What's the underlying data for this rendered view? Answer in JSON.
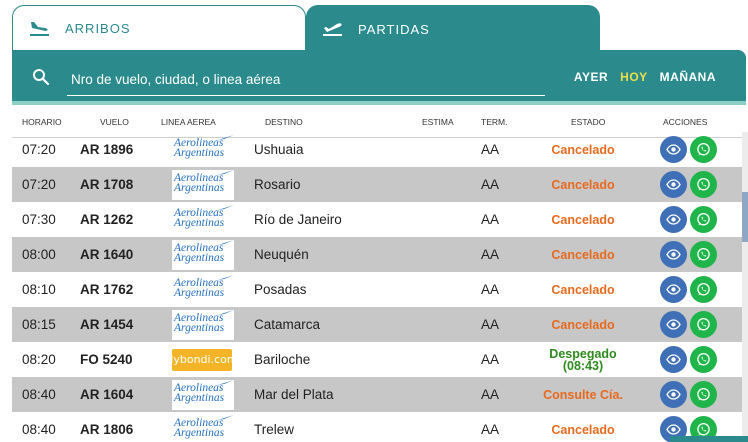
{
  "tabs": {
    "arrivals": "ARRIBOS",
    "departures": "PARTIDAS"
  },
  "search": {
    "placeholder": "Nro de vuelo, ciudad, o linea aérea"
  },
  "days": {
    "yesterday": "AYER",
    "today": "HOY",
    "tomorrow": "MAÑANA"
  },
  "columns": {
    "time": "HORARIO",
    "flight": "VUELO",
    "airline": "LINEA AEREA",
    "destination": "DESTINO",
    "estimate": "ESTIMA",
    "terminal": "TERM.",
    "status": "ESTADO",
    "actions": "ACCIONES"
  },
  "airline_logos": {
    "aerolineas": [
      "Aerolineas",
      "Argentinas"
    ],
    "flybondi": "flybondi.com"
  },
  "colors": {
    "teal": "#2a8a8c",
    "accent_today": "#e8e04a",
    "cancel": "#e86a1f",
    "departed": "#2e8b1e",
    "eye_button": "#3f6fb6",
    "whatsapp_button": "#1fb54a"
  },
  "icons": {
    "arrivals": "plane-landing-icon",
    "departures": "plane-takeoff-icon",
    "search": "search-icon",
    "view": "eye-icon",
    "share": "whatsapp-icon"
  },
  "flights": [
    {
      "time": "07:20",
      "flight": "AR 1896",
      "airline": "aerolineas",
      "destination": "Ushuaia",
      "terminal": "AA",
      "status": "Cancelado",
      "status_type": "cancel"
    },
    {
      "time": "07:20",
      "flight": "AR 1708",
      "airline": "aerolineas",
      "destination": "Rosario",
      "terminal": "AA",
      "status": "Cancelado",
      "status_type": "cancel"
    },
    {
      "time": "07:30",
      "flight": "AR 1262",
      "airline": "aerolineas",
      "destination": "Río de Janeiro",
      "terminal": "AA",
      "status": "Cancelado",
      "status_type": "cancel"
    },
    {
      "time": "08:00",
      "flight": "AR 1640",
      "airline": "aerolineas",
      "destination": "Neuquén",
      "terminal": "AA",
      "status": "Cancelado",
      "status_type": "cancel"
    },
    {
      "time": "08:10",
      "flight": "AR 1762",
      "airline": "aerolineas",
      "destination": "Posadas",
      "terminal": "AA",
      "status": "Cancelado",
      "status_type": "cancel"
    },
    {
      "time": "08:15",
      "flight": "AR 1454",
      "airline": "aerolineas",
      "destination": "Catamarca",
      "terminal": "AA",
      "status": "Cancelado",
      "status_type": "cancel"
    },
    {
      "time": "08:20",
      "flight": "FO 5240",
      "airline": "flybondi",
      "destination": "Bariloche",
      "terminal": "AA",
      "status": "Despegado",
      "status_detail": "(08:43)",
      "status_type": "departed"
    },
    {
      "time": "08:40",
      "flight": "AR 1604",
      "airline": "aerolineas",
      "destination": "Mar del Plata",
      "terminal": "AA",
      "status": "Consulte Cía.",
      "status_type": "cancel"
    },
    {
      "time": "08:40",
      "flight": "AR 1806",
      "airline": "aerolineas",
      "destination": "Trelew",
      "terminal": "AA",
      "status": "Cancelado",
      "status_type": "cancel"
    }
  ]
}
